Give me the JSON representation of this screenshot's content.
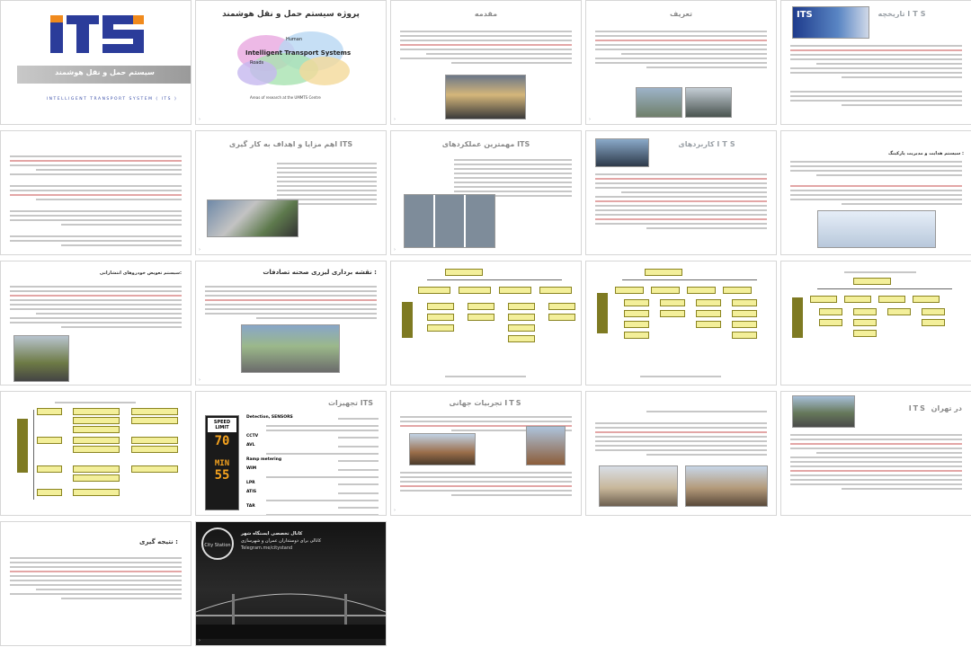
{
  "slides": {
    "s1": {
      "logo": "ITS",
      "subtitle": "سیستم حمل و نقل هوشمند",
      "english": "INTELLIGENT TRANSPORT SYSTEM ( ITS )",
      "colors": {
        "logo_blue": "#2b3c9a",
        "logo_orange": "#f08a1d",
        "band": "#9a9a9a"
      }
    },
    "s2": {
      "title": "پروژه سیستم حمل و نقل هوشمند",
      "diagram_center": "Intelligent Transport Systems",
      "diagram_words": [
        "Human",
        "Roads"
      ],
      "caption": "Areas of research at the UMMTS Centre"
    },
    "s3": {
      "title": "مقدمه"
    },
    "s4": {
      "title": "تعریف"
    },
    "s5": {
      "title": "تاریخچه ITS",
      "thumb_text": "ITS"
    },
    "s6": {
      "title": ""
    },
    "s7": {
      "title": "اهم مزایا و اهداف به کار گیری ITS"
    },
    "s8": {
      "title": "مهمترین عملکردهای ITS"
    },
    "s9": {
      "title": "کاربردهای ITS"
    },
    "s10": {
      "title": "سیستم هدایت و مدیریت پارکینگ :"
    },
    "s11": {
      "title": "سیستم تعویض خودروهای انتشاراتی:"
    },
    "s12": {
      "title": "نقشه برداری لیزری صحنه تصادفات :"
    },
    "s13": {
      "title": ""
    },
    "s14": {
      "title": ""
    },
    "s15": {
      "title": ""
    },
    "s16": {
      "title": ""
    },
    "s17": {
      "title": "تجهیزات ITS",
      "sign_top": "SPEED LIMIT",
      "sign_value_1": "70",
      "sign_min": "MIN",
      "sign_value_2": "55",
      "items": [
        "Detection, SENSORS",
        "CCTV",
        "AVL",
        "Ramp metering",
        "WIM",
        "LPR",
        "ATIS",
        "TAR"
      ]
    },
    "s18": {
      "title": "تجربیات جهانی ITS"
    },
    "s19": {
      "title": ""
    },
    "s20": {
      "title": "ITS در تهران"
    },
    "s21": {
      "title": "نتیجه گیری :"
    },
    "s22": {
      "badge": "City Station",
      "line1": "کانال تخصصی ایستگاه شهر",
      "line2": "کانالی برای دوستداران عمران و شهرسازی",
      "line3": "Telegram.me/citystand"
    }
  }
}
